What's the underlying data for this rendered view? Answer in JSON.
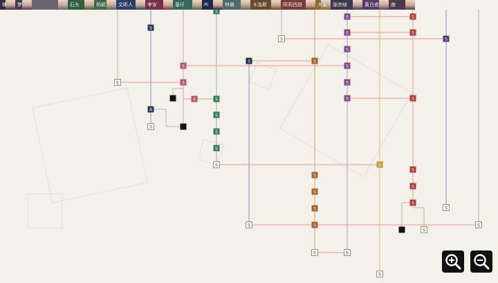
{
  "top_bar": {
    "characters": [
      {
        "label": "律",
        "color": "#3b2a3a"
      },
      {
        "label": "梦",
        "color": "#4a3b55"
      },
      {
        "label": "",
        "color": "#6b6470"
      },
      {
        "label": "石头",
        "color": "#2f5f3f"
      },
      {
        "label": "杨颖",
        "color": "#3f6a48"
      },
      {
        "label": "文昕人",
        "color": "#2d3e6b"
      },
      {
        "label": "李安",
        "color": "#7a2e4a"
      },
      {
        "label": "基仔",
        "color": "#2f6a5a"
      },
      {
        "label": "Pi",
        "color": "#1e2a4a"
      },
      {
        "label": "林晨",
        "color": "#4f6b6e"
      },
      {
        "label": "卡洛斯",
        "color": "#6a4a2a"
      },
      {
        "label": "阿莉西娅",
        "color": "#7a3a3a"
      },
      {
        "label": "大黄",
        "color": "#8a6a2a"
      },
      {
        "label": "张宗岐",
        "color": "#3a3a4a"
      },
      {
        "label": "黄白夜",
        "color": "#5a3a6a"
      },
      {
        "label": "寂",
        "color": "#4a3a4a"
      }
    ]
  },
  "node_labels": {
    "story": "S",
    "ending": "E",
    "alt": "A"
  },
  "controls": {
    "zoom_in": "zoom-in",
    "zoom_out": "zoom-out"
  }
}
